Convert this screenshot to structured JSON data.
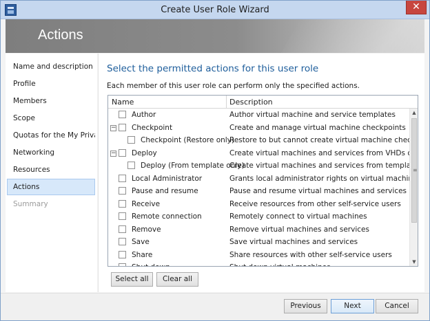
{
  "window": {
    "title": "Create User Role Wizard",
    "close_glyph": "✕"
  },
  "banner": {
    "title": "Actions"
  },
  "nav": {
    "items": [
      {
        "label": "Name and description",
        "state": "normal"
      },
      {
        "label": "Profile",
        "state": "normal"
      },
      {
        "label": "Members",
        "state": "normal"
      },
      {
        "label": "Scope",
        "state": "normal"
      },
      {
        "label": "Quotas for the My Private...",
        "state": "normal"
      },
      {
        "label": "Networking",
        "state": "normal"
      },
      {
        "label": "Resources",
        "state": "normal"
      },
      {
        "label": "Actions",
        "state": "active"
      },
      {
        "label": "Summary",
        "state": "disabled"
      }
    ]
  },
  "main": {
    "heading": "Select the permitted actions for this user role",
    "subtext": "Each member of this user role can perform only the specified actions.",
    "grid": {
      "columns": {
        "name": "Name",
        "description": "Description"
      },
      "rows": [
        {
          "name": "Author",
          "description": "Author virtual machine and service templates",
          "indent": 0,
          "expander": "",
          "checked": false
        },
        {
          "name": "Checkpoint",
          "description": "Create and manage virtual machine checkpoints",
          "indent": 0,
          "expander": "−",
          "checked": false
        },
        {
          "name": "Checkpoint (Restore only)",
          "description": "Restore to but cannot create virtual machine checkpoints",
          "indent": 1,
          "expander": "",
          "checked": false
        },
        {
          "name": "Deploy",
          "description": "Create virtual machines and services from VHDs or templat...",
          "indent": 0,
          "expander": "−",
          "checked": false
        },
        {
          "name": "Deploy (From template only)",
          "description": "Create virtual machines and services from templates only",
          "indent": 1,
          "expander": "",
          "checked": false
        },
        {
          "name": "Local Administrator",
          "description": "Grants local administrator rights on virtual machines",
          "indent": 0,
          "expander": "",
          "checked": false
        },
        {
          "name": "Pause and resume",
          "description": "Pause and resume virtual machines and services",
          "indent": 0,
          "expander": "",
          "checked": false
        },
        {
          "name": "Receive",
          "description": "Receive resources from other self-service users",
          "indent": 0,
          "expander": "",
          "checked": false
        },
        {
          "name": "Remote connection",
          "description": "Remotely connect to virtual machines",
          "indent": 0,
          "expander": "",
          "checked": false
        },
        {
          "name": "Remove",
          "description": "Remove virtual machines and services",
          "indent": 0,
          "expander": "",
          "checked": false
        },
        {
          "name": "Save",
          "description": "Save virtual machines and services",
          "indent": 0,
          "expander": "",
          "checked": false
        },
        {
          "name": "Share",
          "description": "Share resources with other self-service users",
          "indent": 0,
          "expander": "",
          "checked": false
        },
        {
          "name": "Shut down",
          "description": "Shut down virtual machines",
          "indent": 0,
          "expander": "",
          "checked": false
        }
      ],
      "scrollbar": {
        "up_glyph": "▲",
        "down_glyph": "▼",
        "grip_glyph": "≡"
      }
    },
    "select_all_label": "Select all",
    "clear_all_label": "Clear all"
  },
  "footer": {
    "previous_label": "Previous",
    "next_label": "Next",
    "cancel_label": "Cancel"
  }
}
